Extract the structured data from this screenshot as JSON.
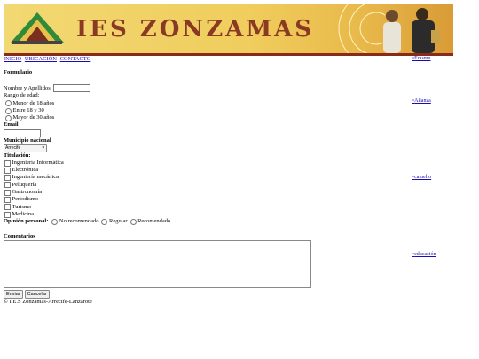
{
  "banner": {
    "title": "IES ZONZAMAS"
  },
  "nav": [
    {
      "label": "INICIO"
    },
    {
      "label": "UBICACIÓN"
    },
    {
      "label": "CONTACTO"
    }
  ],
  "form": {
    "heading": "Formulario",
    "name_label": "Nombre y Apellidos:",
    "name_value": "",
    "age_label": "Rango de edad:",
    "age_options": [
      "Menor de 18 años",
      "Entre 18 y 30",
      "Mayor de 30 años"
    ],
    "email_label": "Email",
    "email_value": "",
    "municipio_label": "Municipio nacional",
    "municipio_value": "Arrecife",
    "titulacion_label": "Titulación:",
    "titulacion_options": [
      "Ingeniería Informática",
      "Electrónica",
      "Ingeniería mecánica",
      "Peluquería",
      "Gastronomía",
      "Periodismo",
      "Turismo",
      "Medicina"
    ],
    "opinion_label": "Opinión personal:",
    "opinion_options": [
      "No recomendado",
      "Regular",
      "Recomendado"
    ],
    "comments_label": "Comentarios",
    "comments_value": "",
    "submit_label": "Enviar",
    "cancel_label": "Cancelar"
  },
  "sidebar": [
    {
      "label": "Erasmu"
    },
    {
      "label": "Alianza"
    },
    {
      "label": "camello"
    },
    {
      "label": "educación"
    }
  ],
  "footer": {
    "text": "© I.E.S Zonzamas-Arrecife-Lanzarote"
  },
  "colors": {
    "banner": "#f0cd5d",
    "banner_border": "#8a2b1a",
    "title": "#8a3a22",
    "link": "#1a0dab"
  }
}
